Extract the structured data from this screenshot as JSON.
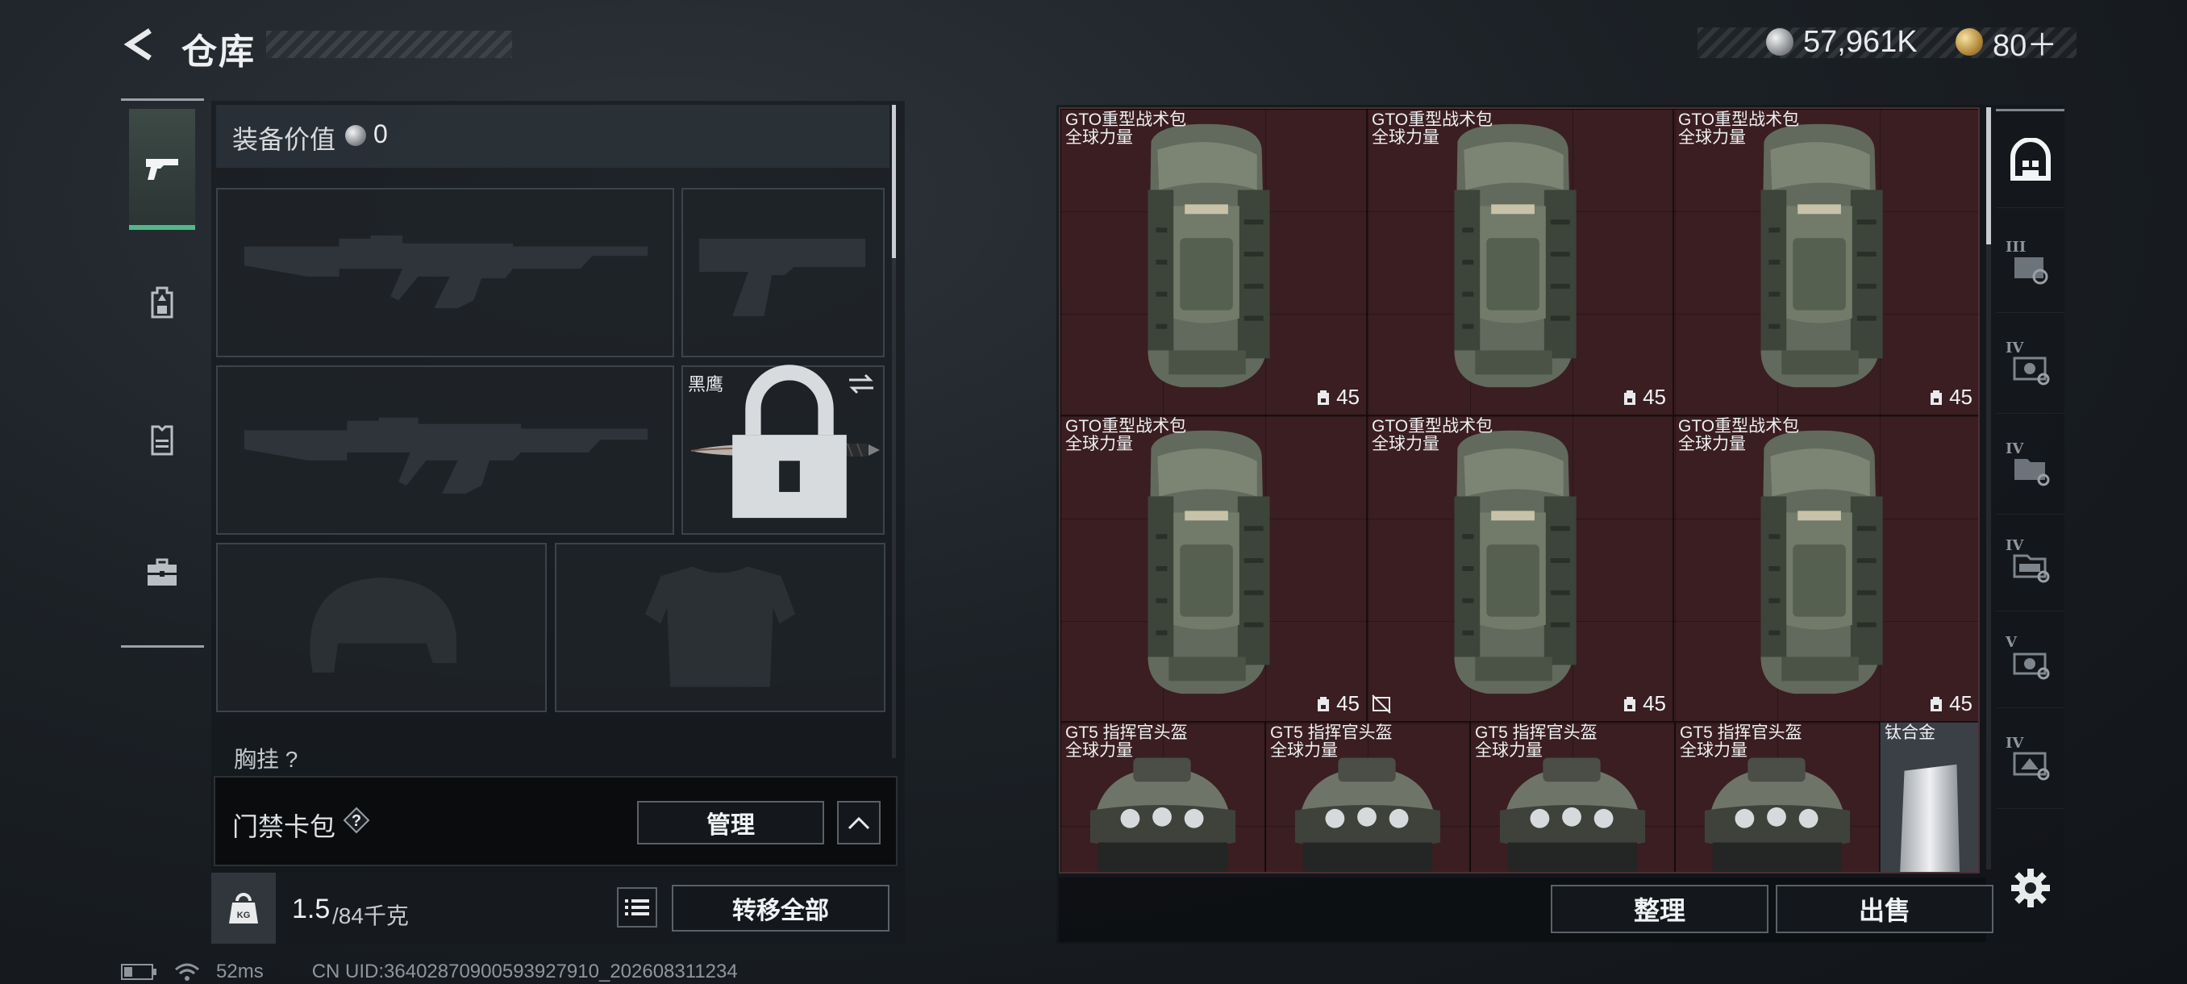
{
  "header": {
    "title": "仓库",
    "currencies": [
      {
        "name": "coin-silver",
        "value": "57,961K"
      },
      {
        "name": "coin-gold",
        "value": "80＋"
      }
    ]
  },
  "left_rail": {
    "tabs": [
      {
        "icon": "pistol-icon",
        "active": true
      },
      {
        "icon": "backpack-icon",
        "active": false
      },
      {
        "icon": "vest-icon",
        "active": false
      },
      {
        "icon": "toolbox-icon",
        "active": false
      }
    ]
  },
  "equipment": {
    "value_label": "装备价值",
    "value": "0",
    "slots": {
      "primary_1": "rifle-silhouette",
      "sidearm": "pistol-silhouette",
      "primary_2": "rifle-silhouette",
      "melee": {
        "label": "黑鹰",
        "locked": true
      },
      "helmet": "helmet-silhouette",
      "body_armor": "armor-silhouette"
    },
    "chest_rig_label": "胸挂 ?"
  },
  "access_card": {
    "label": "门禁卡包",
    "help": "?",
    "manage_label": "管理"
  },
  "weight": {
    "current": "1.5",
    "capacity": "/84千克",
    "transfer_label": "转移全部"
  },
  "status": {
    "ping": "52ms",
    "uid": "CN UID:3640287090059392791​0_202608311234"
  },
  "stash": {
    "items": [
      {
        "name": "GTO重型战术包",
        "sub": "全球力量",
        "level": "45",
        "type": "backpack"
      },
      {
        "name": "GTO重型战术包",
        "sub": "全球力量",
        "level": "45",
        "type": "backpack"
      },
      {
        "name": "GTO重型战术包",
        "sub": "全球力量",
        "level": "45",
        "type": "backpack"
      },
      {
        "name": "GTO重型战术包",
        "sub": "全球力量",
        "level": "45",
        "type": "backpack"
      },
      {
        "name": "GTO重型战术包",
        "sub": "全球力量",
        "level": "45",
        "type": "backpack"
      },
      {
        "name": "GTO重型战术包",
        "sub": "全球力量",
        "level": "45",
        "type": "backpack"
      },
      {
        "name": "GT5 指挥官头盔",
        "sub": "全球力量",
        "type": "helmet"
      },
      {
        "name": "GT5 指挥官头盔",
        "sub": "全球力量",
        "type": "helmet"
      },
      {
        "name": "GT5 指挥官头盔",
        "sub": "全球力量",
        "type": "helmet"
      },
      {
        "name": "GT5 指挥官头盔",
        "sub": "全球力量",
        "type": "helmet"
      },
      {
        "name": "钛合金",
        "type": "material"
      }
    ],
    "sort_label": "整理",
    "sell_label": "出售"
  },
  "right_rail": {
    "tabs": [
      {
        "icon": "stash-home-icon",
        "tier": ""
      },
      {
        "icon": "case-tier-iii-icon",
        "tier": "III"
      },
      {
        "icon": "case-tier-iv-icon",
        "tier": "IV"
      },
      {
        "icon": "case-tier-iv-b-icon",
        "tier": "IV"
      },
      {
        "icon": "case-tier-iv-c-icon",
        "tier": "IV"
      },
      {
        "icon": "case-tier-v-icon",
        "tier": "V"
      },
      {
        "icon": "case-tier-iv-d-icon",
        "tier": "IV"
      }
    ]
  }
}
